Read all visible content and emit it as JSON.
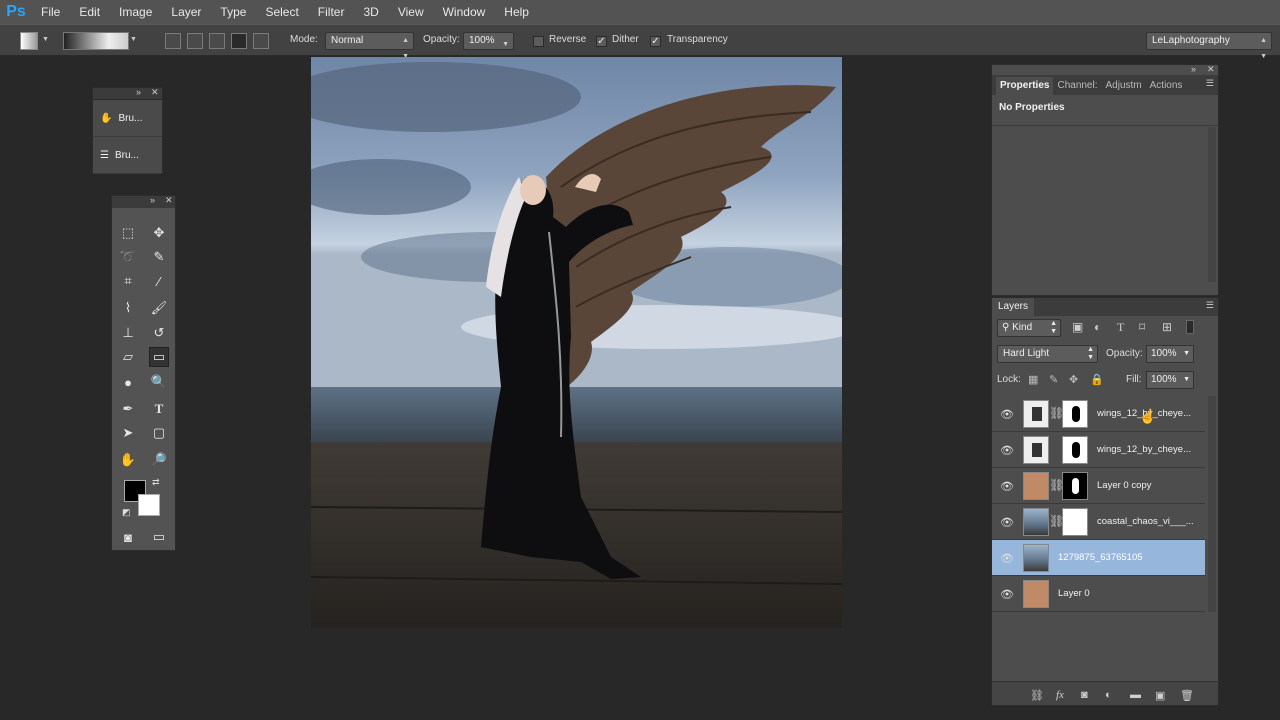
{
  "menubar": {
    "logo": "Ps",
    "items": [
      "File",
      "Edit",
      "Image",
      "Layer",
      "Type",
      "Select",
      "Filter",
      "3D",
      "View",
      "Window",
      "Help"
    ]
  },
  "options": {
    "mode_label": "Mode:",
    "mode_value": "Normal",
    "opacity_label": "Opacity:",
    "opacity_value": "100%",
    "reverse_label": "Reverse",
    "dither_label": "Dither",
    "transparency_label": "Transparency",
    "workspace_value": "LeLaphotography"
  },
  "brushes": {
    "items": [
      {
        "label": "Bru..."
      },
      {
        "label": "Bru..."
      }
    ]
  },
  "properties": {
    "tabs": [
      "Properties",
      "Channel:",
      "Adjustm",
      "Actions"
    ],
    "content": "No Properties"
  },
  "layers": {
    "tab": "Layers",
    "filter_kind": "Kind",
    "blend_mode": "Hard Light",
    "opacity_label": "Opacity:",
    "opacity_value": "100%",
    "lock_label": "Lock:",
    "fill_label": "Fill:",
    "fill_value": "100%",
    "rows": [
      {
        "name": "wings_12_by_cheye...",
        "thumb": "wings",
        "mask": "white-mask-wing",
        "link": true
      },
      {
        "name": "wings_12_by_cheye...",
        "thumb": "wings",
        "mask": "white-mask-wing",
        "link": false
      },
      {
        "name": "Layer 0 copy",
        "thumb": "portrait",
        "mask": "black-mask-figure",
        "link": true
      },
      {
        "name": "coastal_chaos_vi___...",
        "thumb": "sea",
        "mask": "white-mask",
        "link": true
      },
      {
        "name": "1279875_63765105",
        "thumb": "sea",
        "mask": "",
        "link": false,
        "selected": true
      },
      {
        "name": "Layer 0",
        "thumb": "portrait",
        "mask": "",
        "link": false
      }
    ]
  },
  "colors": {
    "foreground": "#000000",
    "background": "#ffffff",
    "selected_layer": "#97b6dc",
    "accent_logo": "#2fa3f5"
  }
}
